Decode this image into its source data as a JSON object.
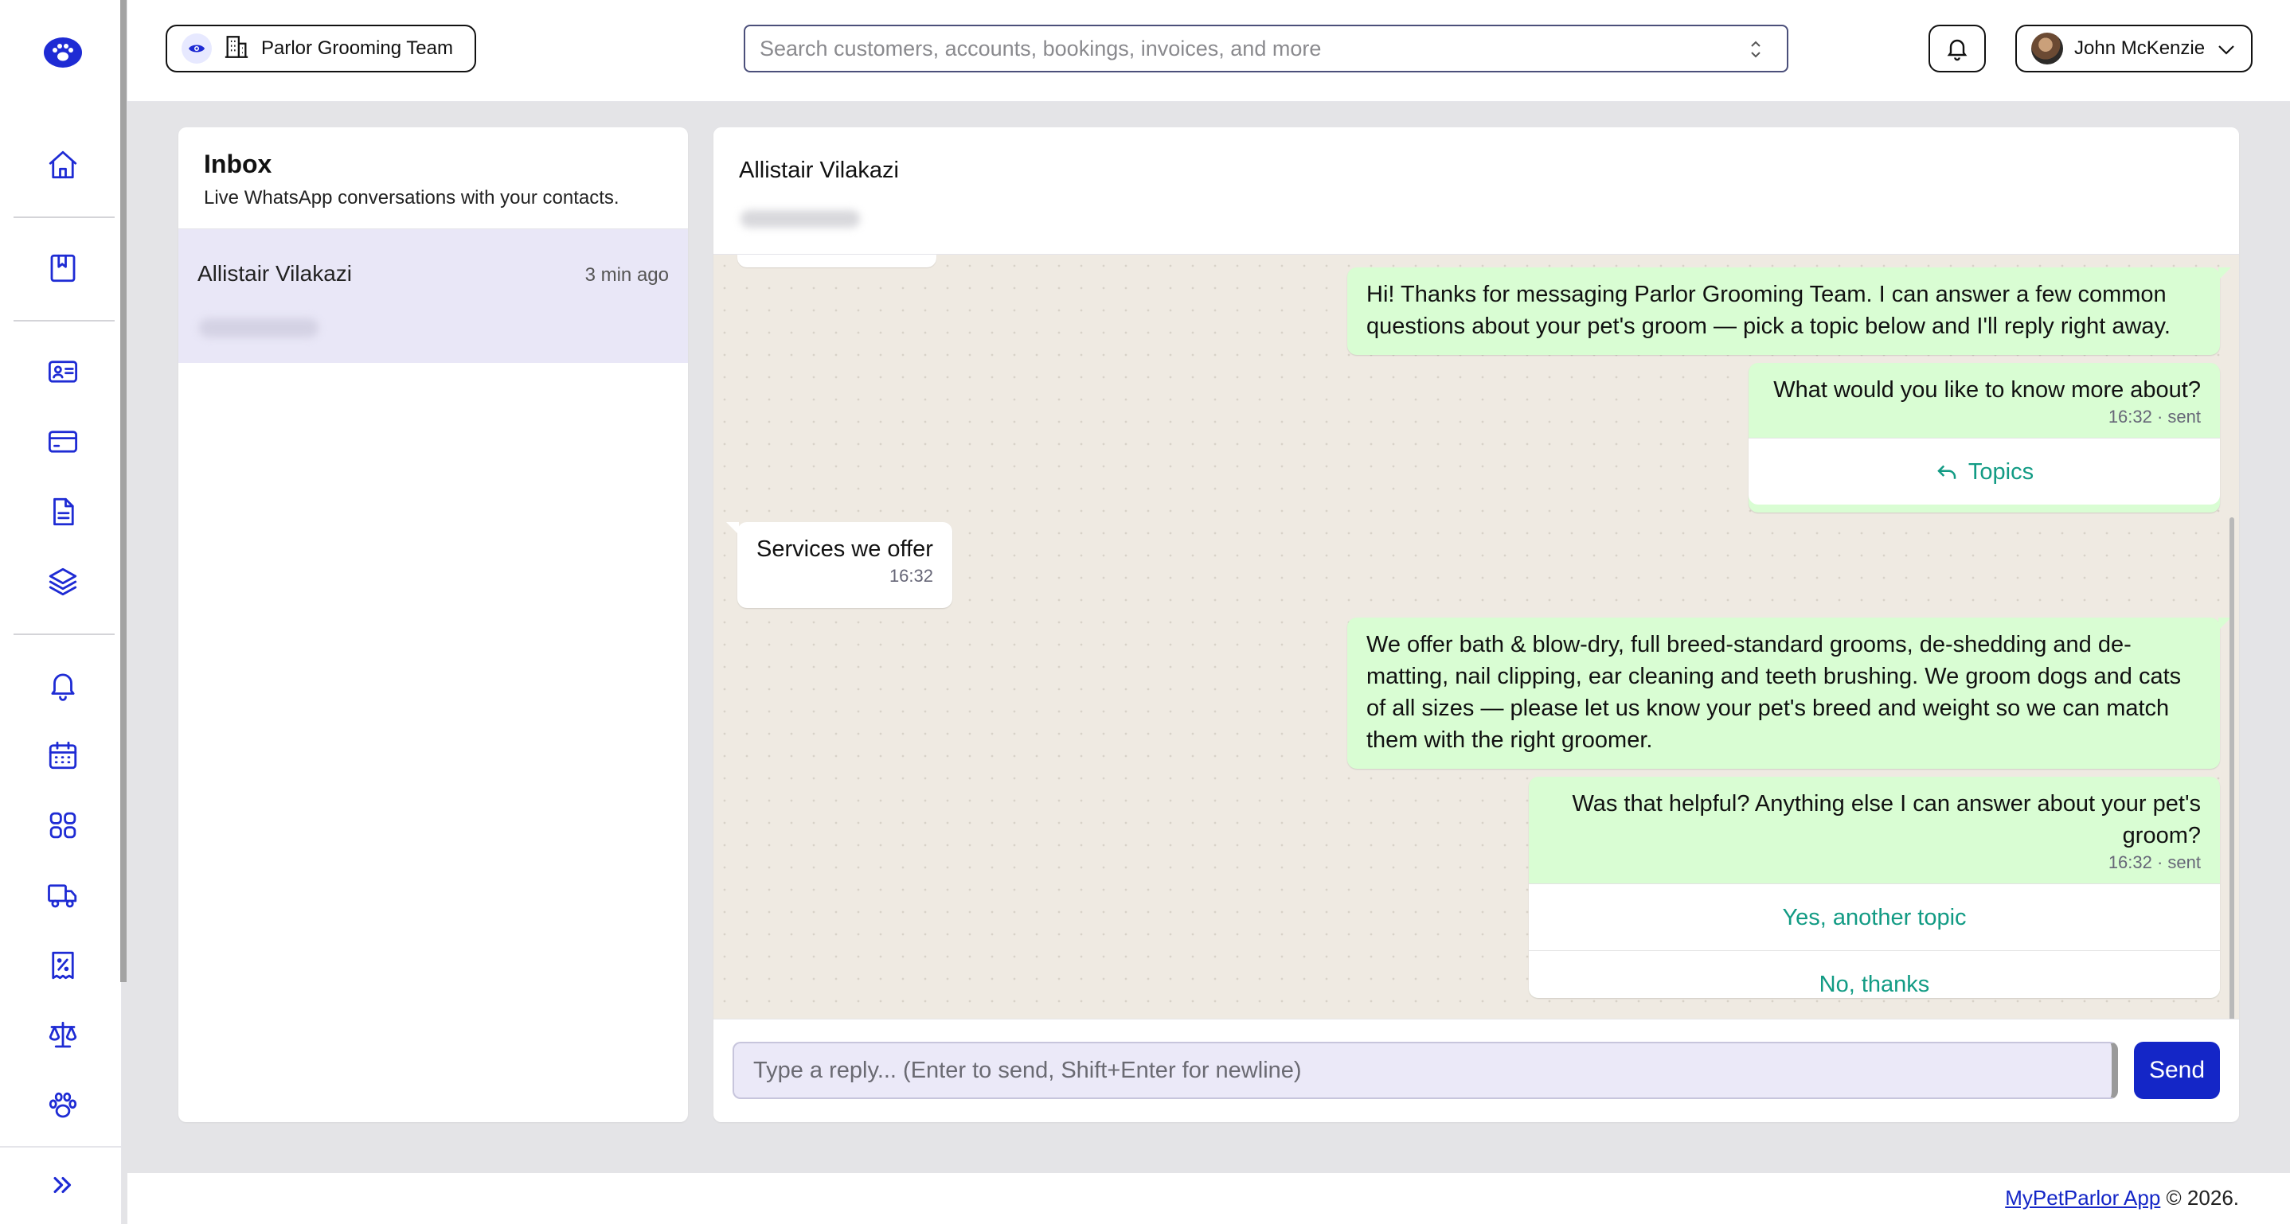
{
  "brand": {
    "accent": "#1e2bd4",
    "send_color": "#1426c7",
    "outgoing_bubble": "#d9fdd3",
    "chat_bg": "#efeae2",
    "button_text": "#129b84"
  },
  "sidebar": {
    "logo": "paw-logo-icon",
    "items": [
      {
        "icon": "home-icon"
      },
      {
        "icon": "bookmark-book-icon"
      },
      {
        "icon": "contact-card-icon"
      },
      {
        "icon": "credit-card-icon"
      },
      {
        "icon": "document-icon"
      },
      {
        "icon": "layers-icon"
      },
      {
        "icon": "bell-icon"
      },
      {
        "icon": "calendar-icon"
      },
      {
        "icon": "apps-grid-icon"
      },
      {
        "icon": "truck-icon"
      },
      {
        "icon": "receipt-percent-icon"
      },
      {
        "icon": "scale-icon"
      },
      {
        "icon": "paw-icon"
      }
    ],
    "expand_icon": "double-chevron-right-icon"
  },
  "topbar": {
    "team_name": "Parlor Grooming Team",
    "search_placeholder": "Search customers, accounts, bookings, invoices, and more",
    "user_name": "John McKenzie"
  },
  "inbox": {
    "title": "Inbox",
    "subtitle": "Live WhatsApp conversations with your contacts.",
    "conversations": [
      {
        "name": "Allistair Vilakazi",
        "time": "3 min ago"
      }
    ]
  },
  "chat": {
    "contact_name": "Allistair Vilakazi",
    "messages": [
      {
        "dir": "out",
        "text": "Hi! Thanks for messaging Parlor Grooming Team. I can answer a few common questions about your pet's groom — pick a topic below and I'll reply right away."
      },
      {
        "dir": "out",
        "text": "What would you like to know more about?",
        "meta": "16:32 · sent",
        "buttons": [
          "Topics"
        ]
      },
      {
        "dir": "in",
        "text": "Services we offer",
        "meta": "16:32"
      },
      {
        "dir": "out",
        "text": "We offer bath & blow-dry, full breed-standard grooms, de-shedding and de-matting, nail clipping, ear cleaning and teeth brushing. We groom dogs and cats of all sizes — please let us know your pet's breed and weight so we can match them with the right groomer."
      },
      {
        "dir": "out",
        "text": "Was that helpful? Anything else I can answer about your pet's groom?",
        "meta": "16:32 · sent",
        "buttons": [
          "Yes, another topic",
          "No, thanks"
        ]
      }
    ],
    "reply_placeholder": "Type a reply... (Enter to send, Shift+Enter for newline)",
    "send_label": "Send"
  },
  "footer": {
    "link_text": "MyPetParlor App",
    "suffix": " © 2026."
  }
}
